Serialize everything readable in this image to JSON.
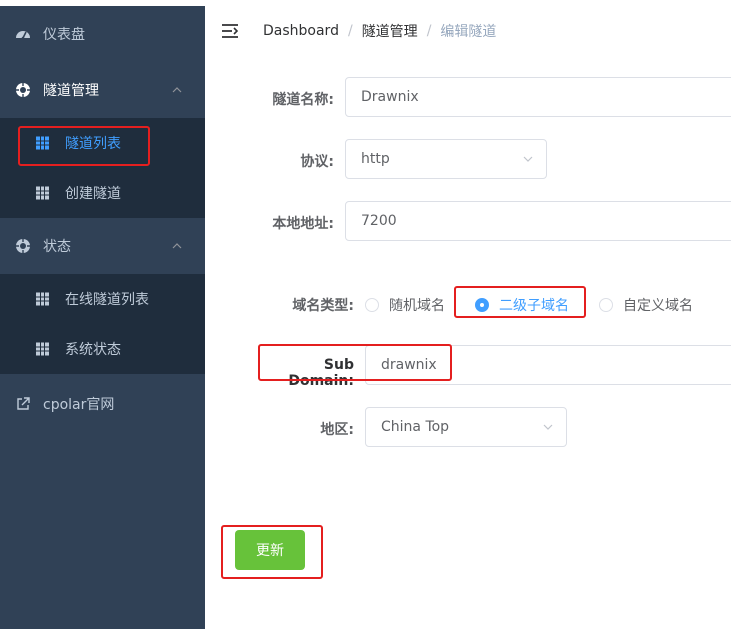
{
  "sidebar": {
    "dashboard": "仪表盘",
    "tunnel_mgmt": "隧道管理",
    "tunnel_list": "隧道列表",
    "create_tunnel": "创建隧道",
    "status": "状态",
    "online_tunnels": "在线隧道列表",
    "system_status": "系统状态",
    "cpolar_site": "cpolar官网"
  },
  "breadcrumb": {
    "home": "Dashboard",
    "section": "隧道管理",
    "current": "编辑隧道",
    "separator": "/"
  },
  "form": {
    "name_label": "隧道名称:",
    "name_value": "Drawnix",
    "protocol_label": "协议:",
    "protocol_value": "http",
    "local_label": "本地地址:",
    "local_value": "7200",
    "domain_type_label": "域名类型:",
    "domain_type_options": [
      "随机域名",
      "二级子域名",
      "自定义域名"
    ],
    "domain_type_selected": "二级子域名",
    "subdomain_label": "Sub Domain:",
    "subdomain_value": "drawnix",
    "region_label": "地区:",
    "region_value": "China Top",
    "update_button": "更新"
  },
  "colors": {
    "sidebar_bg": "#304156",
    "submenu_bg": "#1f2d3d",
    "active": "#409eff",
    "button_green": "#67c23a",
    "highlight_red": "#e41f1f"
  }
}
